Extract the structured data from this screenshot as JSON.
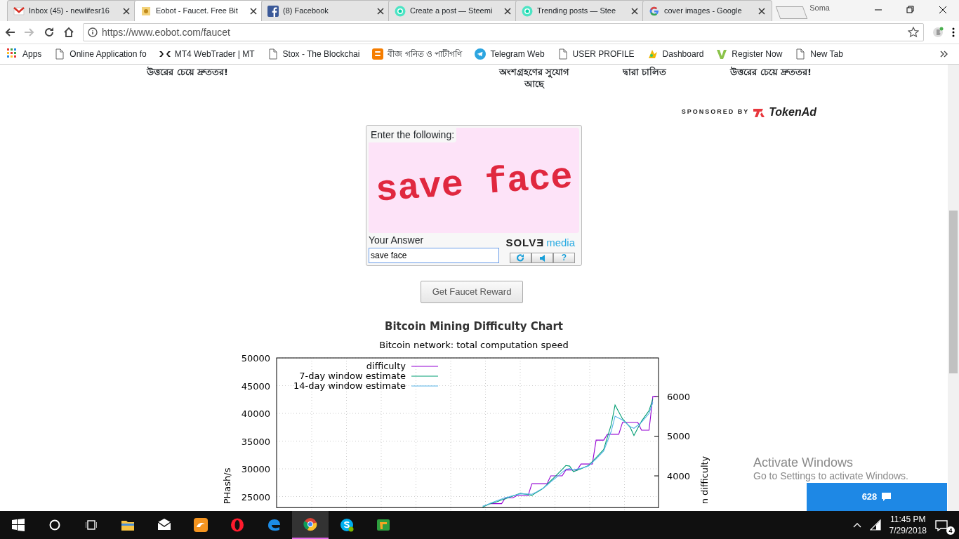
{
  "browser": {
    "tabs": [
      {
        "kind": "mail",
        "title": "Inbox (45) - newlifesr16",
        "selected": false
      },
      {
        "kind": "coin",
        "title": "Eobot - Faucet. Free Bit",
        "selected": true
      },
      {
        "kind": "facebook",
        "title": "(8) Facebook",
        "selected": false
      },
      {
        "kind": "steem",
        "title": "Create a post — Steemi",
        "selected": false
      },
      {
        "kind": "steem",
        "title": "Trending posts — Stee",
        "selected": false
      },
      {
        "kind": "google",
        "title": "cover images - Google",
        "selected": false
      }
    ],
    "profile": "Soma",
    "url": "https://www.eobot.com/faucet",
    "bookmarks": [
      {
        "kind": "apps",
        "label": "Apps"
      },
      {
        "kind": "page",
        "label": "Online Application fo"
      },
      {
        "kind": "xm",
        "label": "MT4 WebTrader | MT"
      },
      {
        "kind": "page",
        "label": "Stox - The Blockchai"
      },
      {
        "kind": "blogger",
        "label": "বীজ গনিত ও পাটীগণি"
      },
      {
        "kind": "telegram",
        "label": "Telegram Web"
      },
      {
        "kind": "page",
        "label": "USER PROFILE"
      },
      {
        "kind": "dash",
        "label": "Dashboard"
      },
      {
        "kind": "v",
        "label": "Register Now"
      },
      {
        "kind": "page",
        "label": "New Tab"
      }
    ]
  },
  "page": {
    "promo_texts": [
      [
        "উত্তরের চেয়ে দ্রুততর!"
      ],
      [
        "অংশগ্রহণের সুযোগ",
        "আছে"
      ],
      [
        "দ্বারা চালিত"
      ],
      [
        "উত্তরের চেয়ে দ্রুততর!"
      ]
    ],
    "sponsor": {
      "label": "SPONSORED BY",
      "brand": "TokenAd"
    },
    "captcha": {
      "prompt": "Enter the following:",
      "challenge": "save face",
      "answer_label": "Your Answer",
      "answer": "save face",
      "logo_left": "SOLVƎ",
      "logo_right": "media",
      "help": "?"
    },
    "reward_button": "Get Faucet Reward",
    "chart_heading": "Bitcoin Mining Difficulty Chart",
    "chart_data": {
      "type": "line",
      "title": "Bitcoin network: total computation speed",
      "ylabel": "PHash/s",
      "y2label": "n difficulty",
      "ylim": [
        23000,
        50000
      ],
      "y2lim": [
        3200,
        6970
      ],
      "grid": true,
      "legend": "upper left",
      "yticks": [
        25000,
        30000,
        35000,
        40000,
        45000,
        50000
      ],
      "y2ticks": [
        4000,
        5000,
        6000
      ],
      "categories": [
        null,
        null,
        null,
        null,
        null,
        null,
        null,
        null,
        null,
        null,
        null,
        null,
        null,
        null,
        null,
        null,
        null,
        null,
        null,
        null,
        null,
        null,
        null,
        null,
        null,
        null,
        null,
        null,
        null,
        null,
        null,
        null,
        null,
        null,
        null,
        null,
        null,
        null,
        null,
        null,
        null,
        null,
        null,
        null,
        null,
        null,
        null,
        null,
        null,
        null,
        null,
        null,
        null,
        null,
        null,
        null,
        null,
        null,
        null,
        null,
        null,
        null,
        null,
        null,
        null,
        null,
        null,
        null,
        null,
        null,
        null,
        null,
        null,
        null,
        null,
        null,
        null,
        null,
        null,
        null,
        null,
        null,
        null,
        null,
        null,
        null,
        null,
        null,
        null,
        null,
        null,
        null,
        null,
        null,
        null,
        null,
        null,
        null,
        null,
        null,
        null
      ],
      "series": [
        {
          "name": "difficulty",
          "color": "#9400d3",
          "axis": "y2",
          "values": [
            null,
            null,
            null,
            null,
            null,
            null,
            null,
            null,
            null,
            null,
            null,
            null,
            null,
            null,
            null,
            null,
            null,
            null,
            null,
            null,
            null,
            null,
            null,
            null,
            null,
            null,
            null,
            null,
            null,
            null,
            null,
            null,
            null,
            null,
            null,
            null,
            null,
            null,
            null,
            null,
            null,
            null,
            null,
            null,
            null,
            null,
            null,
            null,
            null,
            null,
            null,
            null,
            null,
            null,
            null,
            null,
            3300,
            3300,
            3300,
            3300,
            3450,
            3450,
            3450,
            3500,
            3500,
            3500,
            3500,
            3800,
            3800,
            3800,
            3800,
            3800,
            4000,
            4000,
            4000,
            4000,
            4150,
            4150,
            4150,
            4150,
            4300,
            4300,
            4300,
            4300,
            4900,
            4900,
            4900,
            5050,
            5050,
            5050,
            5050,
            5350,
            5350,
            5350,
            5350,
            5350,
            5150,
            5150,
            5150,
            6000,
            6000
          ]
        },
        {
          "name": "7-day window estimate",
          "color": "#009e73",
          "values": [
            null,
            null,
            null,
            null,
            null,
            null,
            null,
            null,
            null,
            null,
            null,
            null,
            null,
            null,
            null,
            null,
            null,
            null,
            null,
            null,
            null,
            null,
            null,
            null,
            null,
            null,
            null,
            null,
            null,
            null,
            null,
            null,
            null,
            null,
            null,
            null,
            null,
            null,
            null,
            null,
            null,
            null,
            null,
            null,
            null,
            null,
            null,
            null,
            null,
            null,
            null,
            null,
            null,
            null,
            23100,
            23400,
            23700,
            23900,
            24100,
            24400,
            24600,
            24850,
            25100,
            25350,
            25600,
            25450,
            25350,
            25200,
            25650,
            26050,
            26500,
            27150,
            27850,
            28500,
            29200,
            29900,
            30600,
            30500,
            29500,
            29750,
            30000,
            30300,
            30600,
            31300,
            32000,
            32750,
            33500,
            35750,
            38000,
            41500,
            40250,
            39000,
            38250,
            37500,
            36000,
            37300,
            38600,
            39550,
            40500,
            42600,
            null
          ]
        },
        {
          "name": "14-day window estimate",
          "color": "#56b4e9",
          "values": [
            null,
            null,
            null,
            null,
            null,
            null,
            null,
            null,
            null,
            null,
            null,
            null,
            null,
            null,
            null,
            null,
            null,
            null,
            null,
            null,
            null,
            null,
            null,
            null,
            null,
            null,
            null,
            null,
            null,
            null,
            null,
            null,
            null,
            null,
            null,
            null,
            null,
            null,
            null,
            null,
            null,
            null,
            null,
            null,
            null,
            null,
            null,
            null,
            null,
            null,
            null,
            null,
            null,
            null,
            23250,
            23500,
            23800,
            24050,
            24300,
            24550,
            24800,
            24950,
            25150,
            25300,
            25500,
            25450,
            25450,
            25400,
            25750,
            26150,
            26500,
            27050,
            27650,
            28200,
            28750,
            29350,
            29900,
            30050,
            29800,
            29950,
            30100,
            30300,
            30500,
            31150,
            31800,
            32500,
            33200,
            35000,
            36800,
            39500,
            39150,
            38800,
            38200,
            37600,
            37300,
            37850,
            38400,
            39200,
            40000,
            42000,
            null
          ]
        }
      ]
    }
  },
  "chat": {
    "count": "628"
  },
  "activation": {
    "title": "Activate Windows",
    "subtitle": "Go to Settings to activate Windows."
  },
  "taskbar": {
    "apps": [
      {
        "kind": "explorer",
        "active": false
      },
      {
        "kind": "mail",
        "active": false
      },
      {
        "kind": "uc",
        "active": false
      },
      {
        "kind": "opera",
        "active": false
      },
      {
        "kind": "edge",
        "active": false
      },
      {
        "kind": "chrome",
        "active": true
      },
      {
        "kind": "skype",
        "active": false
      },
      {
        "kind": "green",
        "active": false
      }
    ],
    "time": "11:45 PM",
    "date": "7/29/2018",
    "notifications": "4"
  }
}
